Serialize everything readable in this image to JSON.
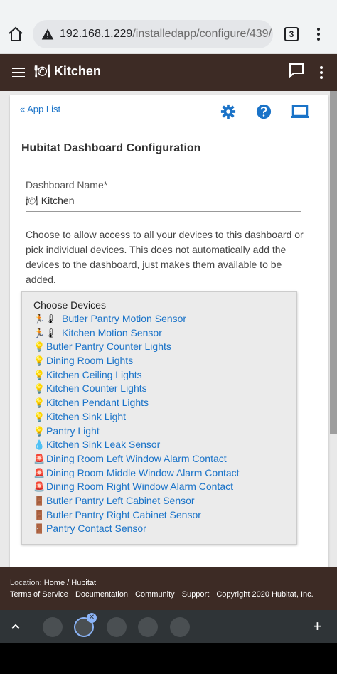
{
  "browser": {
    "url_host": "192.168.1.229",
    "url_path": "/installedapp/configure/439/",
    "tab_count": "3"
  },
  "appbar": {
    "title": "Kitchen",
    "title_emoji": "🍽"
  },
  "toolbar": {
    "app_list_link": "« App List"
  },
  "page": {
    "heading": "Hubitat Dashboard Configuration",
    "dashboard_name_label": "Dashboard Name*",
    "dashboard_name_emoji": "🍽",
    "dashboard_name_value": "Kitchen",
    "help_text": "Choose to allow access to all your devices to this dashboard or pick individual devices. This does not automatically add the devices to the dashboard, just makes them available to be added."
  },
  "devices": {
    "label": "Choose Devices",
    "items": [
      {
        "emoji": "🏃🌡",
        "name": "Butler Pantry Motion Sensor"
      },
      {
        "emoji": "🏃🌡",
        "name": "Kitchen Motion Sensor"
      },
      {
        "emoji": "💡",
        "name": "Butler Pantry Counter Lights"
      },
      {
        "emoji": "💡",
        "name": "Dining Room Lights"
      },
      {
        "emoji": "💡",
        "name": "Kitchen Ceiling Lights"
      },
      {
        "emoji": "💡",
        "name": "Kitchen Counter Lights"
      },
      {
        "emoji": "💡",
        "name": "Kitchen Pendant Lights"
      },
      {
        "emoji": "💡",
        "name": "Kitchen Sink Light"
      },
      {
        "emoji": "💡",
        "name": "Pantry Light"
      },
      {
        "emoji": "💧",
        "name": "Kitchen Sink Leak Sensor"
      },
      {
        "emoji": "🚨",
        "name": "Dining Room Left Window Alarm Contact"
      },
      {
        "emoji": "🚨",
        "name": "Dining Room Middle Window Alarm Contact"
      },
      {
        "emoji": "🚨",
        "name": "Dining Room Right Window Alarm Contact"
      },
      {
        "emoji": "🚪",
        "name": "Butler Pantry Left Cabinet Sensor"
      },
      {
        "emoji": "🚪",
        "name": "Butler Pantry Right Cabinet Sensor"
      },
      {
        "emoji": "🚪",
        "name": "Pantry Contact Sensor"
      }
    ]
  },
  "footer": {
    "location_label": "Location:",
    "location_value": "Home / Hubitat",
    "links": [
      "Terms of Service",
      "Documentation",
      "Community",
      "Support"
    ],
    "copyright": "Copyright 2020 Hubitat, Inc."
  },
  "colors": {
    "appbar_bg": "#3d2b25",
    "link": "#1a73c8"
  }
}
